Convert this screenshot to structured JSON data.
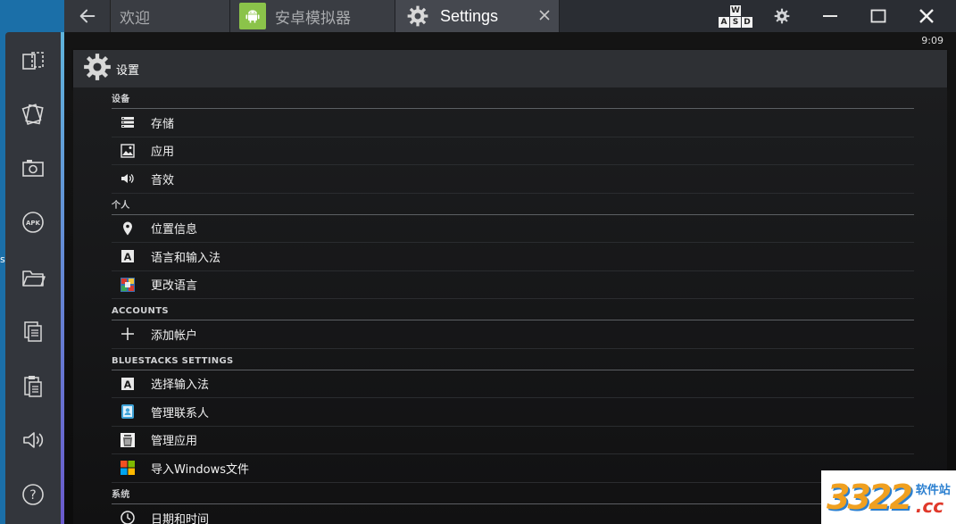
{
  "tabs": [
    {
      "label": "欢迎"
    },
    {
      "label": "安卓模拟器"
    },
    {
      "label": "Settings"
    }
  ],
  "keyboard": {
    "top": "W",
    "bottom": [
      "A",
      "S",
      "D"
    ]
  },
  "sidebar_icons": [
    "rotate-icon",
    "shake-icon",
    "camera-icon",
    "apk-icon",
    "folder-icon",
    "copy-icon",
    "paste-icon",
    "volume-icon",
    "help-icon"
  ],
  "sidebar_apk_text": "APK",
  "sidebar_help_text": "?",
  "desktop_fragment": "s",
  "status": {
    "time": "9:09"
  },
  "actionbar": {
    "title": "设置"
  },
  "sections": [
    {
      "header": "设备",
      "items": [
        {
          "label": "存储",
          "icon": "storage-icon"
        },
        {
          "label": "应用",
          "icon": "apps-icon"
        },
        {
          "label": "音效",
          "icon": "sound-icon"
        }
      ]
    },
    {
      "header": "个人",
      "items": [
        {
          "label": "位置信息",
          "icon": "location-icon"
        },
        {
          "label": "语言和输入法",
          "icon": "language-input-icon",
          "glyph": "A"
        },
        {
          "label": "更改语言",
          "icon": "change-language-icon"
        }
      ]
    },
    {
      "header": "ACCOUNTS",
      "items": [
        {
          "label": "添加帐户",
          "icon": "plus-icon"
        }
      ]
    },
    {
      "header": "BLUESTACKS SETTINGS",
      "items": [
        {
          "label": "选择输入法",
          "icon": "input-method-icon",
          "glyph": "A"
        },
        {
          "label": "管理联系人",
          "icon": "contacts-icon"
        },
        {
          "label": "管理应用",
          "icon": "manage-apps-icon"
        },
        {
          "label": "导入Windows文件",
          "icon": "windows-icon"
        }
      ]
    },
    {
      "header": "系统",
      "items": [
        {
          "label": "日期和时间",
          "icon": "clock-icon"
        }
      ]
    }
  ],
  "watermark": {
    "number": "3322",
    "site": "软件站",
    "suffix": ".cc"
  },
  "colors": {
    "accent_top": "#5fb4dc",
    "accent_bottom": "#6a5acd",
    "android_green": "#8bc34a",
    "desktop_blue": "#1b6fa8"
  }
}
